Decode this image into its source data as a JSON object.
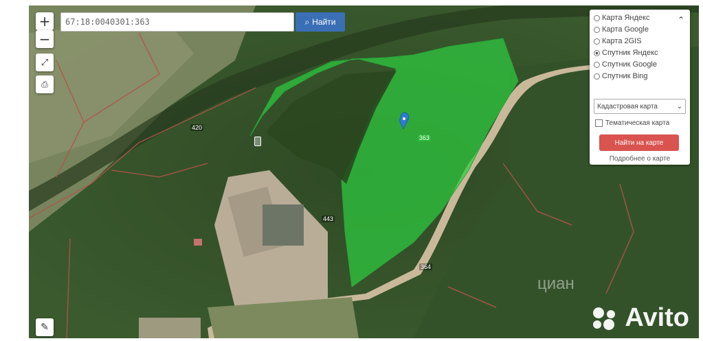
{
  "search": {
    "value": "67:18:0040301:363"
  },
  "toolbar": {
    "zoom_in": "+",
    "zoom_out": "−",
    "find_label": "Найти"
  },
  "layers": {
    "options": [
      {
        "label": "Карта Яндекс",
        "selected": false
      },
      {
        "label": "Карта Google",
        "selected": false
      },
      {
        "label": "Карта 2GIS",
        "selected": false
      },
      {
        "label": "Спутник Яндекс",
        "selected": true
      },
      {
        "label": "Спутник Google",
        "selected": false
      },
      {
        "label": "Спутник Bing",
        "selected": false
      }
    ],
    "select_value": "Кадастровая карта",
    "checkbox_label": "Тематическая карта",
    "action_button": "Найти на карте",
    "link_text": "Подробнее о карте"
  },
  "plots": [
    "420",
    "363",
    "443",
    "364"
  ],
  "watermark": {
    "brand": "Avito",
    "secondary": "циан"
  },
  "colors": {
    "parcel": "#2ecc40",
    "button_blue": "#3a6fb5",
    "button_red": "#d9534f",
    "boundary": "#b0554a"
  }
}
